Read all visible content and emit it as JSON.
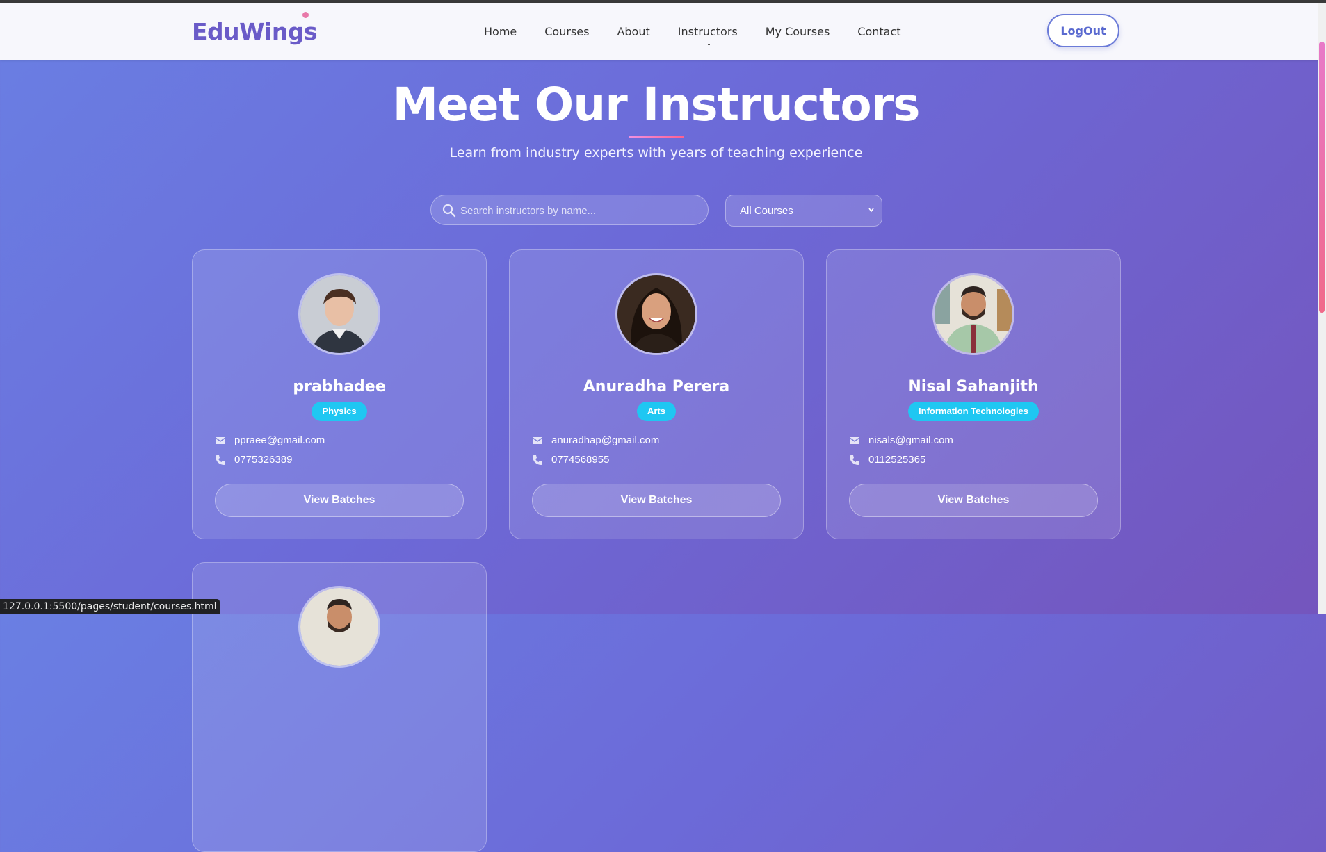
{
  "nav": {
    "logo": "EduWings",
    "links": [
      "Home",
      "Courses",
      "About",
      "Instructors",
      "My Courses",
      "Contact"
    ],
    "active": "Instructors",
    "logout": "LogOut"
  },
  "hero": {
    "title": "Meet Our Instructors",
    "subtitle": "Learn from industry experts with years of teaching experience"
  },
  "filters": {
    "search_placeholder": "Search instructors by name...",
    "course_select": "All Courses"
  },
  "instructors": [
    {
      "name": "prabhadee",
      "subject": "Physics",
      "email": "ppraee@gmail.com",
      "phone": "0775326389",
      "button": "View Batches"
    },
    {
      "name": "Anuradha Perera",
      "subject": "Arts",
      "email": "anuradhap@gmail.com",
      "phone": "0774568955",
      "button": "View Batches"
    },
    {
      "name": "Nisal Sahanjith",
      "subject": "Information Technologies",
      "email": "nisals@gmail.com",
      "phone": "0112525365",
      "button": "View Batches"
    }
  ],
  "status_url": "127.0.0.1:5500/pages/student/courses.html",
  "colors": {
    "accent": "#6a5bc8",
    "badge": "#1fc7f2",
    "underline_start": "#f092e2",
    "underline_end": "#ff5f8f"
  }
}
